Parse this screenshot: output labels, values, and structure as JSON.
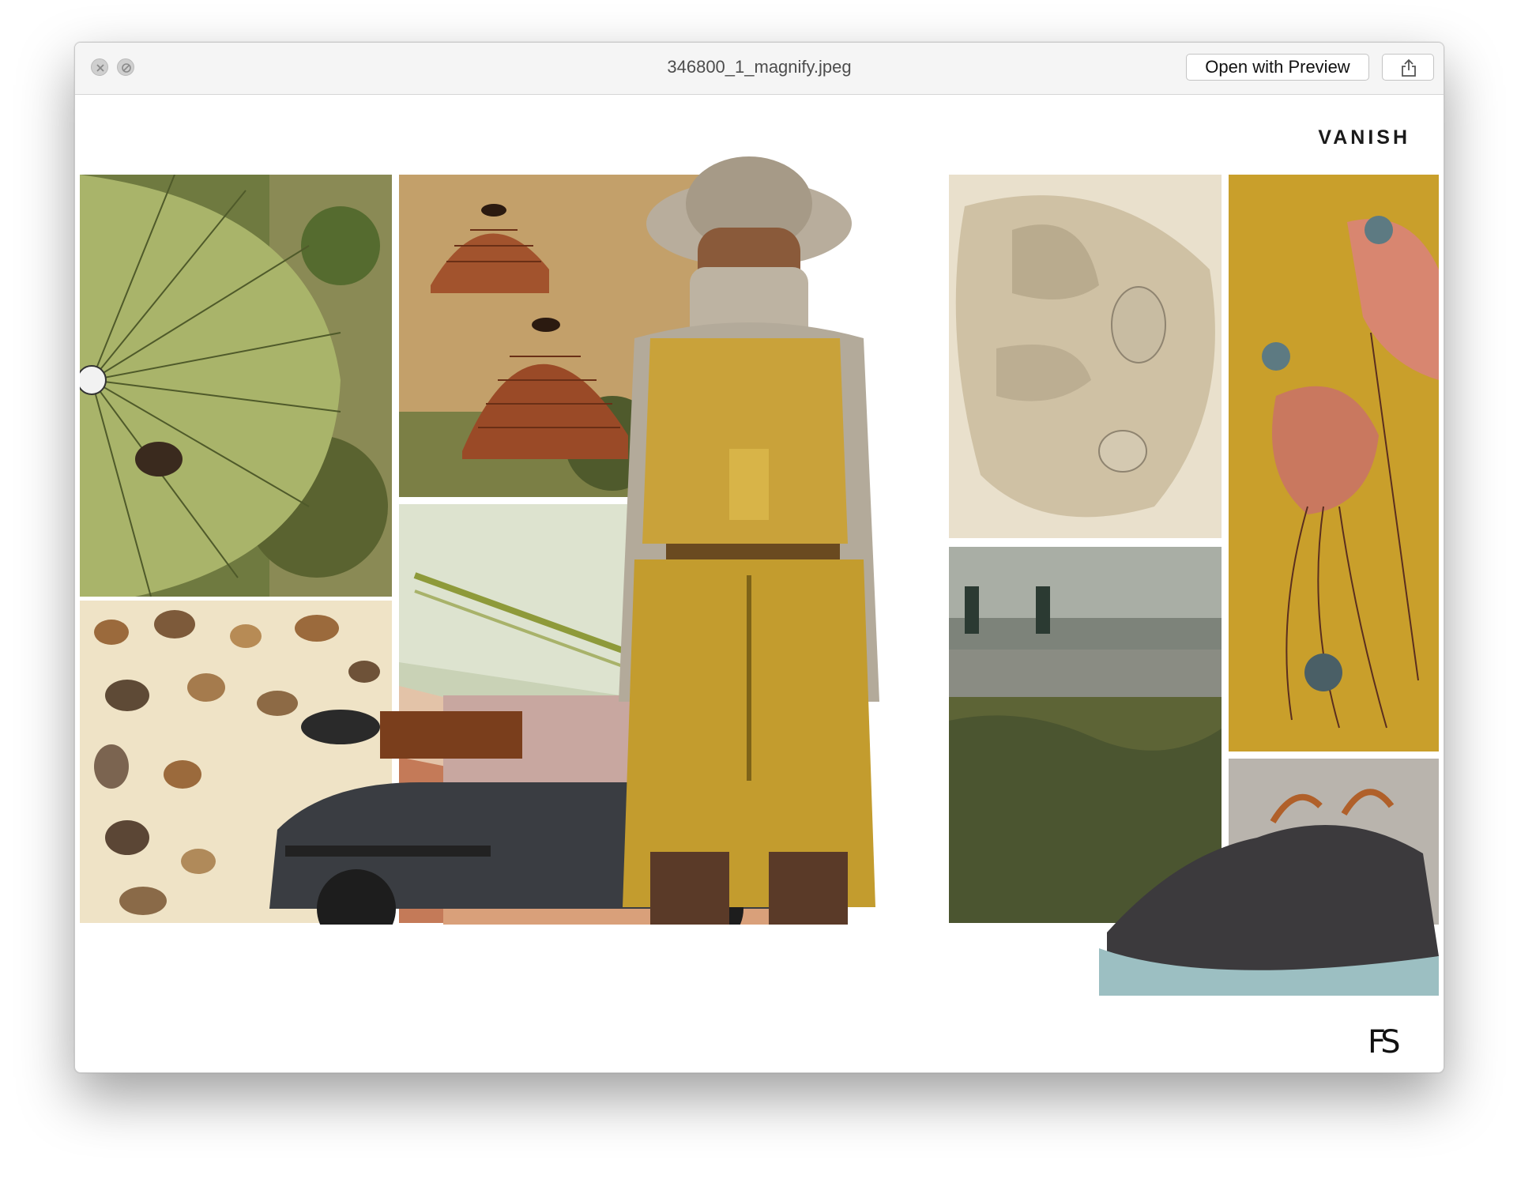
{
  "window": {
    "title": "346800_1_magnify.jpeg",
    "open_with_label": "Open with Preview",
    "close_icon": "close-icon",
    "minimize_icon": "minimize-icon",
    "share_icon": "share-icon"
  },
  "image": {
    "brand_text": "VANISH",
    "logo_text": "FS",
    "panels": [
      "parachute",
      "dome-huts",
      "ceramic-forms",
      "flowers-hands",
      "fabric",
      "model",
      "grass-building",
      "minerals",
      "offroad-car",
      "sneaker"
    ]
  },
  "colors": {
    "titlebar": "#f5f5f5",
    "mustard": "#c9a33a",
    "olive": "#8a9a4a"
  }
}
